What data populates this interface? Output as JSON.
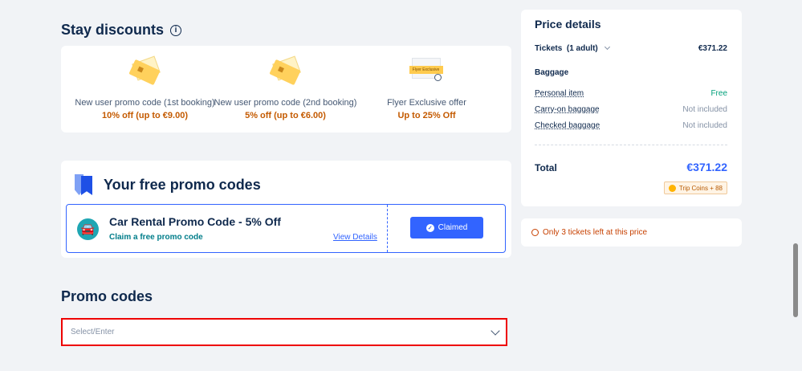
{
  "stay_discounts": {
    "title": "Stay discounts",
    "info_icon": "i",
    "items": [
      {
        "label": "New user promo code (1st booking)",
        "value": "10% off (up to €9.00)"
      },
      {
        "label": "New user promo code (2nd booking)",
        "value": "5% off (up to €6.00)"
      },
      {
        "label": "Flyer Exclusive offer",
        "value": "Up to 25% Off",
        "image_text": "Flyer Exclusive"
      }
    ]
  },
  "free_promo": {
    "title": "Your free promo codes",
    "coupon": {
      "title": "Car Rental Promo Code - 5% Off",
      "subtitle": "Claim a free promo code",
      "link": "View Details",
      "button": "Claimed"
    }
  },
  "promo_codes": {
    "title": "Promo codes",
    "placeholder": "Select/Enter"
  },
  "price_details": {
    "title": "Price details",
    "tickets_label": "Tickets",
    "tickets_qty": "(1 adult)",
    "tickets_price": "€371.22",
    "baggage_label": "Baggage",
    "baggage": [
      {
        "label": "Personal item",
        "value": "Free"
      },
      {
        "label": "Carry-on baggage",
        "value": "Not included"
      },
      {
        "label": "Checked baggage",
        "value": "Not included"
      }
    ],
    "total_label": "Total",
    "total_value": "€371.22",
    "coins": "Trip Coins + 88"
  },
  "alert": {
    "text": "Only 3 tickets left at this price"
  },
  "colors": {
    "accent": "#3264ff",
    "discount_value": "#c45a00",
    "alert": "#c74000",
    "highlight_border": "#ee0000"
  }
}
